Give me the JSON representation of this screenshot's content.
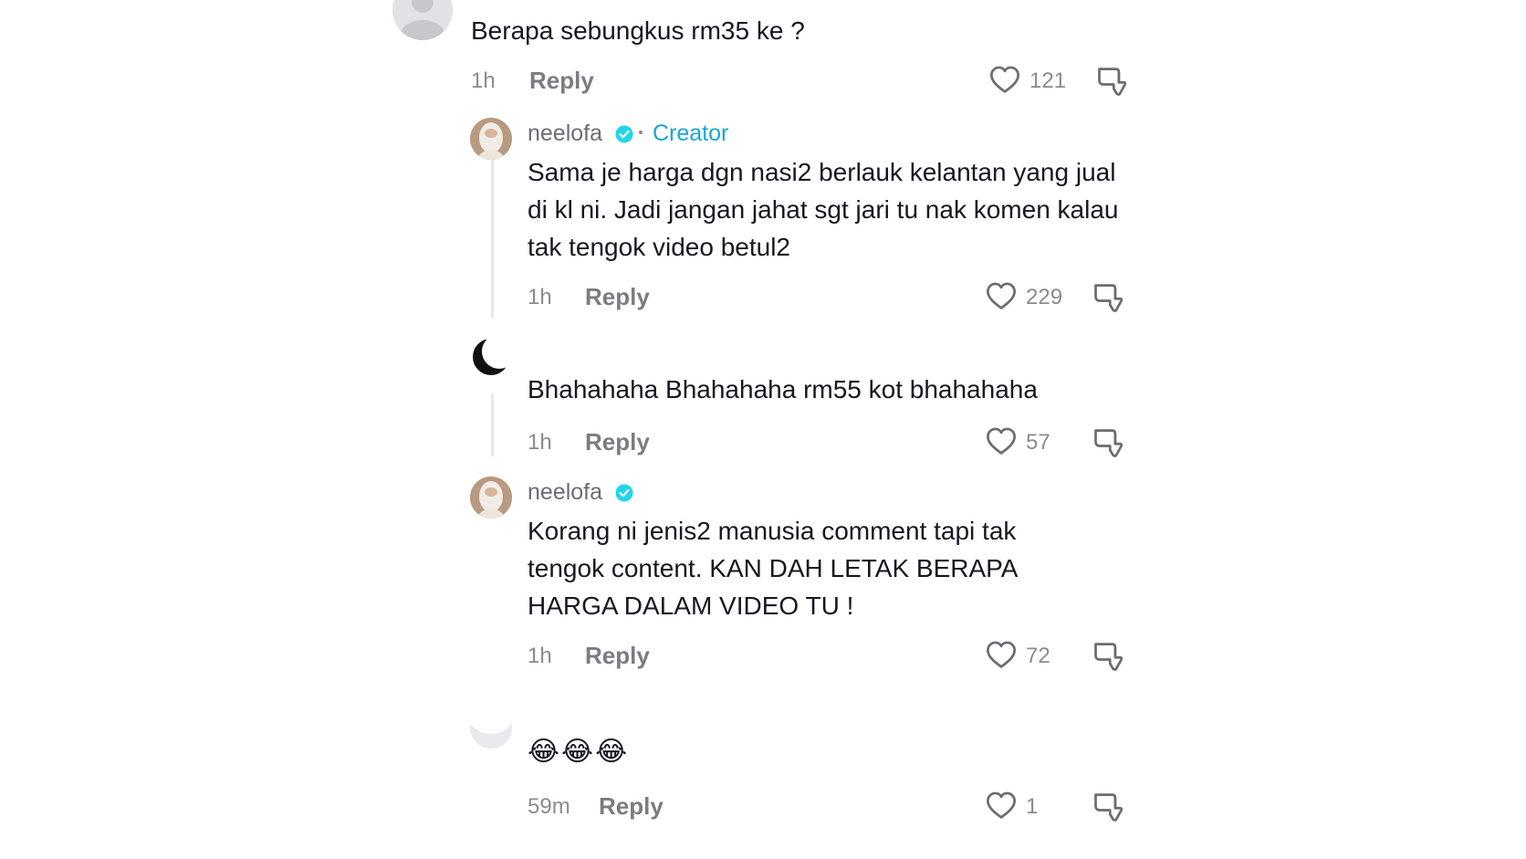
{
  "comments": [
    {
      "text": "Berapa sebungkus rm35 ke ?",
      "time": "1h",
      "reply_label": "Reply",
      "likes": "121"
    },
    {
      "username": "neelofa",
      "creator_label": "Creator",
      "text": "Sama je harga dgn nasi2 berlauk kelantan yang jual di kl ni. Jadi jangan jahat sgt jari tu nak komen kalau tak tengok video betul2",
      "time": "1h",
      "reply_label": "Reply",
      "likes": "229"
    },
    {
      "text": "Bhahahaha Bhahahaha rm55 kot bhahahaha",
      "time": "1h",
      "reply_label": "Reply",
      "likes": "57"
    },
    {
      "username": "neelofa",
      "text": "Korang ni jenis2 manusia comment tapi tak tengok content. KAN DAH LETAK BERAPA HARGA DALAM VIDEO TU !",
      "time": "1h",
      "reply_label": "Reply",
      "likes": "72"
    },
    {
      "text": "😂😂😂",
      "time": "59m",
      "reply_label": "Reply",
      "likes": "1"
    }
  ],
  "colors": {
    "verified_badge": "#20d5ec",
    "creator_tag": "#18a6d6",
    "icon_stroke": "#6b6c72"
  },
  "icons": [
    "heart-outline-icon",
    "thumbs-down-icon",
    "verified-badge-icon"
  ]
}
